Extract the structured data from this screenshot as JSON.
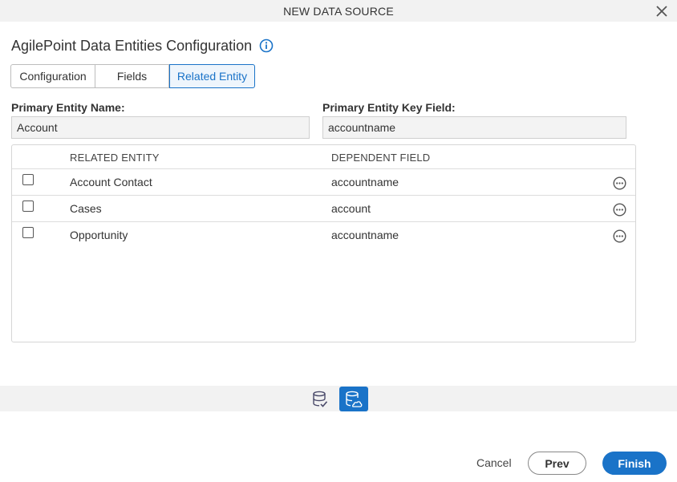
{
  "dialog": {
    "title": "NEW DATA SOURCE",
    "close_icon": "close-icon"
  },
  "heading": {
    "text": "AgilePoint Data Entities Configuration",
    "info_icon": "info-icon"
  },
  "tabs": [
    {
      "label": "Configuration",
      "active": false
    },
    {
      "label": "Fields",
      "active": false
    },
    {
      "label": "Related Entity",
      "active": true
    }
  ],
  "form": {
    "primary_entity_name_label": "Primary Entity Name:",
    "primary_entity_name_value": "Account",
    "primary_entity_key_field_label": "Primary Entity Key Field:",
    "primary_entity_key_field_value": "accountname"
  },
  "grid": {
    "columns": [
      "RELATED ENTITY",
      "DEPENDENT FIELD"
    ],
    "rows": [
      {
        "related_entity": "Account Contact",
        "dependent_field": "accountname",
        "checked": false
      },
      {
        "related_entity": "Cases",
        "dependent_field": "account",
        "checked": false
      },
      {
        "related_entity": "Opportunity",
        "dependent_field": "accountname",
        "checked": false
      }
    ]
  },
  "steps": [
    {
      "icon": "database-check-icon",
      "active": false
    },
    {
      "icon": "database-cloud-icon",
      "active": true
    }
  ],
  "footer": {
    "cancel_label": "Cancel",
    "prev_label": "Prev",
    "finish_label": "Finish"
  },
  "colors": {
    "accent": "#1a73c8",
    "band": "#f2f2f2",
    "input_bg": "#f3f3f3"
  }
}
